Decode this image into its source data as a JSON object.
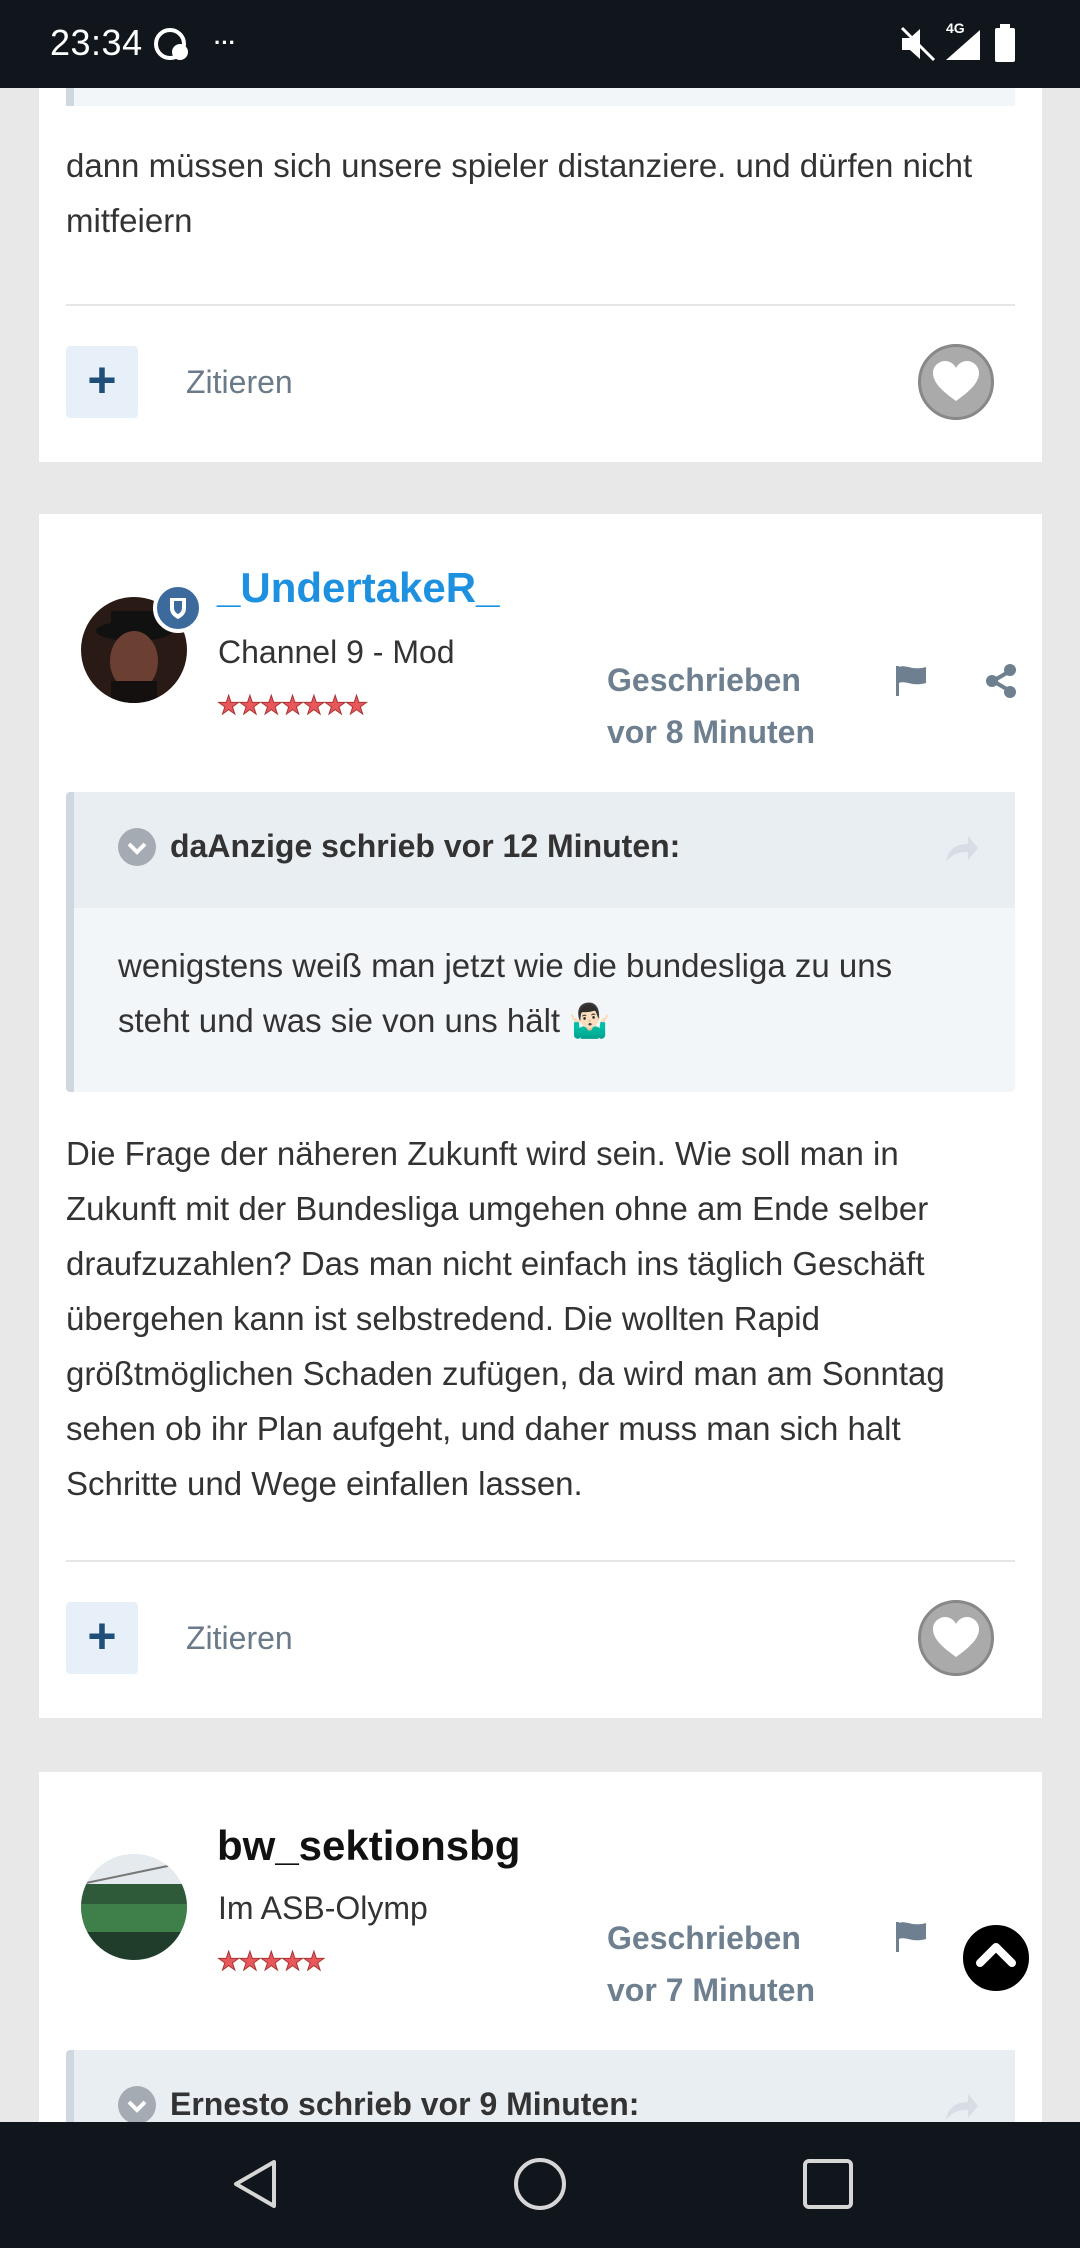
{
  "status_bar": {
    "time": "23:34",
    "network": "4G"
  },
  "post_top": {
    "text": "dann müssen sich unsere spieler distanziere. und dürfen nicht mitfeiern",
    "quote_label": "Zitieren"
  },
  "post_mid": {
    "username": "_UndertakeR_",
    "user_title": "Channel 9 - Mod",
    "stars": "★★★★★★★",
    "posted_line1": "Geschrieben",
    "posted_line2": "vor 8 Minuten",
    "quote_header": "daAnzige schrieb vor 12 Minuten:",
    "quote_text_line1": "wenigstens weiß man jetzt wie die bundesliga zu uns",
    "quote_text_line2": "steht und was sie von uns hält 🤷🏻‍♂️",
    "body_lines": [
      "Die Frage der näheren Zukunft wird sein. Wie soll man in",
      "Zukunft mit der Bundesliga umgehen ohne am Ende selber",
      "draufzuzahlen? Das man nicht einfach ins täglich Geschäft",
      "übergehen kann ist selbstredend. Die wollten Rapid",
      "größtmöglichen Schaden zufügen, da wird man am Sonntag",
      "sehen ob ihr Plan aufgeht, und daher muss man sich halt",
      "Schritte und Wege einfallen lassen."
    ],
    "quote_label": "Zitieren",
    "username_color": "#1e90e0"
  },
  "post_bottom": {
    "username": "bw_sektionsbg",
    "user_title": "Im ASB-Olymp",
    "stars": "★★★★★",
    "posted_line1": "Geschrieben",
    "posted_line2": "vor 7 Minuten",
    "quote_header": "Ernesto schrieb vor 9 Minuten:"
  },
  "icons": {
    "like": "heart-icon",
    "report": "flag-icon",
    "share": "share-icon",
    "scroll_top": "chevron-up-icon",
    "nav_back": "triangle-back-icon",
    "nav_home": "circle-home-icon",
    "nav_recents": "square-recents-icon"
  }
}
